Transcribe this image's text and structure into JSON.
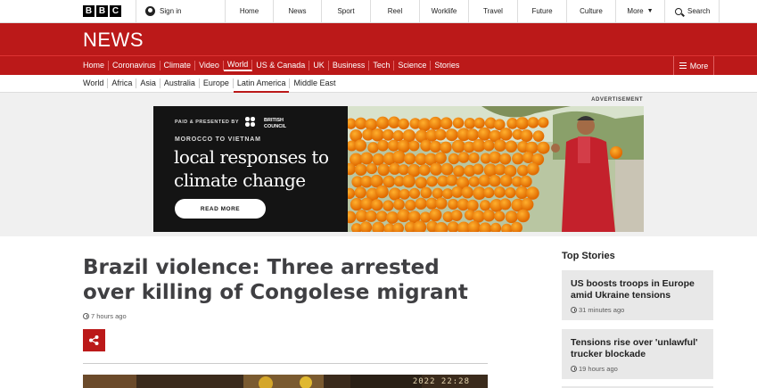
{
  "masthead": {
    "logo_letters": [
      "B",
      "B",
      "C"
    ],
    "signin_label": "Sign in",
    "nav": [
      "Home",
      "News",
      "Sport",
      "Reel",
      "Worklife",
      "Travel",
      "Future",
      "Culture"
    ],
    "more_label": "More",
    "search_label": "Search"
  },
  "news": {
    "wordmark": "NEWS",
    "nav": [
      "Home",
      "Coronavirus",
      "Climate",
      "Video",
      "World",
      "US & Canada",
      "UK",
      "Business",
      "Tech",
      "Science",
      "Stories"
    ],
    "active_nav": "World",
    "more_label": "More"
  },
  "world_nav": {
    "items": [
      "World",
      "Africa",
      "Asia",
      "Australia",
      "Europe",
      "Latin America",
      "Middle East"
    ],
    "active": "Latin America"
  },
  "ad": {
    "label": "ADVERTISEMENT",
    "paid_text": "PAID & PRESENTED BY",
    "sponsor": "BRITISH COUNCIL",
    "route": "MOROCCO TO VIETNAM",
    "headline": "local responses to climate change",
    "cta": "READ MORE"
  },
  "article": {
    "title": "Brazil violence: Three arrested over killing of Congolese migrant",
    "timestamp": "7 hours ago",
    "share_icon": "share-icon",
    "image_stamp": "2022 22:28"
  },
  "top_stories": {
    "heading": "Top Stories",
    "items": [
      {
        "headline": "US boosts troops in Europe amid Ukraine tensions",
        "time": "31 minutes ago"
      },
      {
        "headline": "Tensions rise over 'unlawful' trucker blockade",
        "time": "19 hours ago"
      }
    ]
  },
  "colors": {
    "brand_red": "#bb1919",
    "ad_background": "#141414"
  }
}
